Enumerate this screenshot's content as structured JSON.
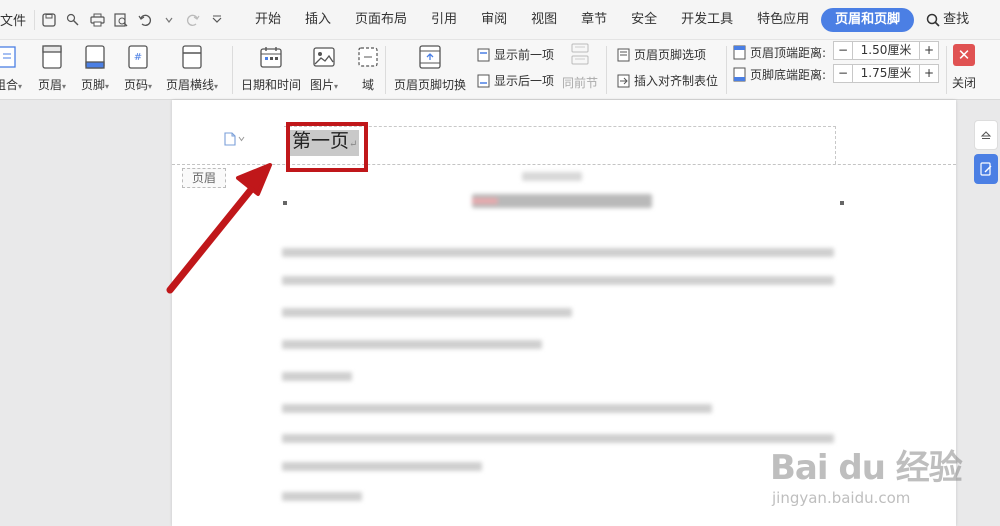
{
  "menu": {
    "file": "文件",
    "tabs": [
      "开始",
      "插入",
      "页面布局",
      "引用",
      "审阅",
      "视图",
      "章节",
      "安全",
      "开发工具",
      "特色应用",
      "页眉和页脚"
    ],
    "active_tab": "页眉和页脚",
    "search": "查找"
  },
  "ribbon": {
    "combo": "组合",
    "header": "页眉",
    "footer": "页脚",
    "page_num": "页码",
    "header_line": "页眉横线",
    "datetime": "日期和时间",
    "picture": "图片",
    "field": "域",
    "switch": "页眉页脚切换",
    "show_prev": "显示前一项",
    "show_next": "显示后一项",
    "same_as_prev": "同前节",
    "hf_options": "页眉页脚选项",
    "insert_align_tab": "插入对齐制表位",
    "top_distance_label": "页眉顶端距离:",
    "top_distance_value": "1.50厘米",
    "bottom_distance_label": "页脚底端距离:",
    "bottom_distance_value": "1.75厘米",
    "close": "关闭"
  },
  "document": {
    "header_text": "第一页",
    "header_tag": "页眉"
  },
  "watermark": {
    "brand": "Bai  du 经验",
    "url": "jingyan.baidu.com"
  },
  "colors": {
    "accent": "#4b7fe4",
    "highlight_box": "#c0171a",
    "close": "#e05252"
  }
}
